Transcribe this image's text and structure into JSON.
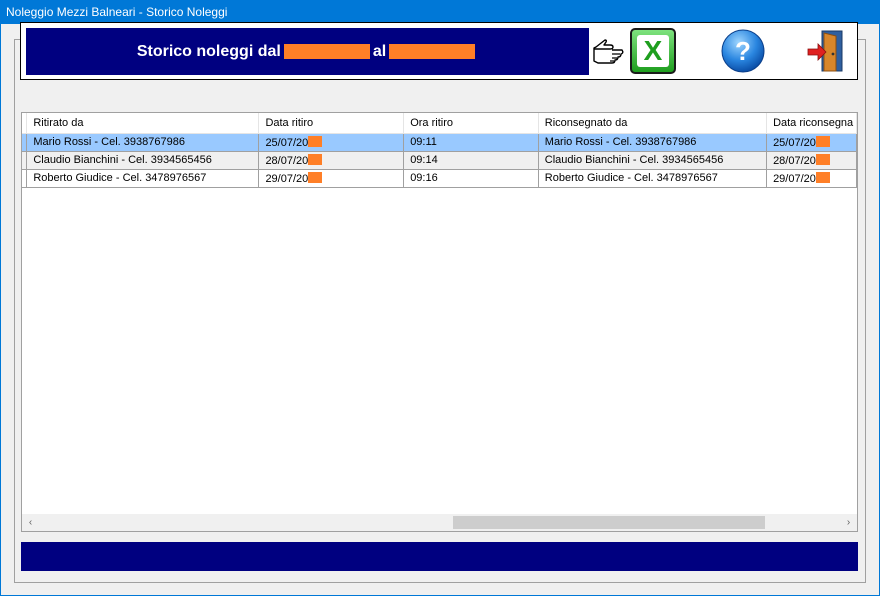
{
  "window": {
    "title": "Noleggio Mezzi Balneari - Storico Noleggi"
  },
  "header": {
    "title_prefix": "Storico noleggi dal",
    "title_mid": "al"
  },
  "icons": {
    "pointer": "hand-pointer-icon",
    "excel": "excel-export-icon",
    "help": "help-icon",
    "exit": "exit-door-icon",
    "excel_glyph": "X",
    "help_glyph": "?"
  },
  "table": {
    "columns": [
      "Ritirato da",
      "Data ritiro",
      "Ora ritiro",
      "Riconsegnato da",
      "Data riconsegna"
    ],
    "rows": [
      [
        "Mario Rossi - Cel. 3938767986",
        "25/07/20",
        "09:11",
        "Mario Rossi - Cel. 3938767986",
        "25/07/20"
      ],
      [
        "Claudio Bianchini - Cel. 3934565456",
        "28/07/20",
        "09:14",
        "Claudio Bianchini - Cel. 3934565456",
        "28/07/20"
      ],
      [
        "Roberto Giudice - Cel. 3478976567",
        "29/07/20",
        "09:16",
        "Roberto Giudice - Cel. 3478976567",
        "29/07/20"
      ]
    ],
    "selected_row": 0
  },
  "scrollbar": {
    "left_arrow": "‹",
    "right_arrow": "›"
  },
  "colors": {
    "banner": "#000080",
    "redaction": "#ff7f27",
    "selection": "#99c9ff",
    "titlebar": "#0078d7"
  }
}
